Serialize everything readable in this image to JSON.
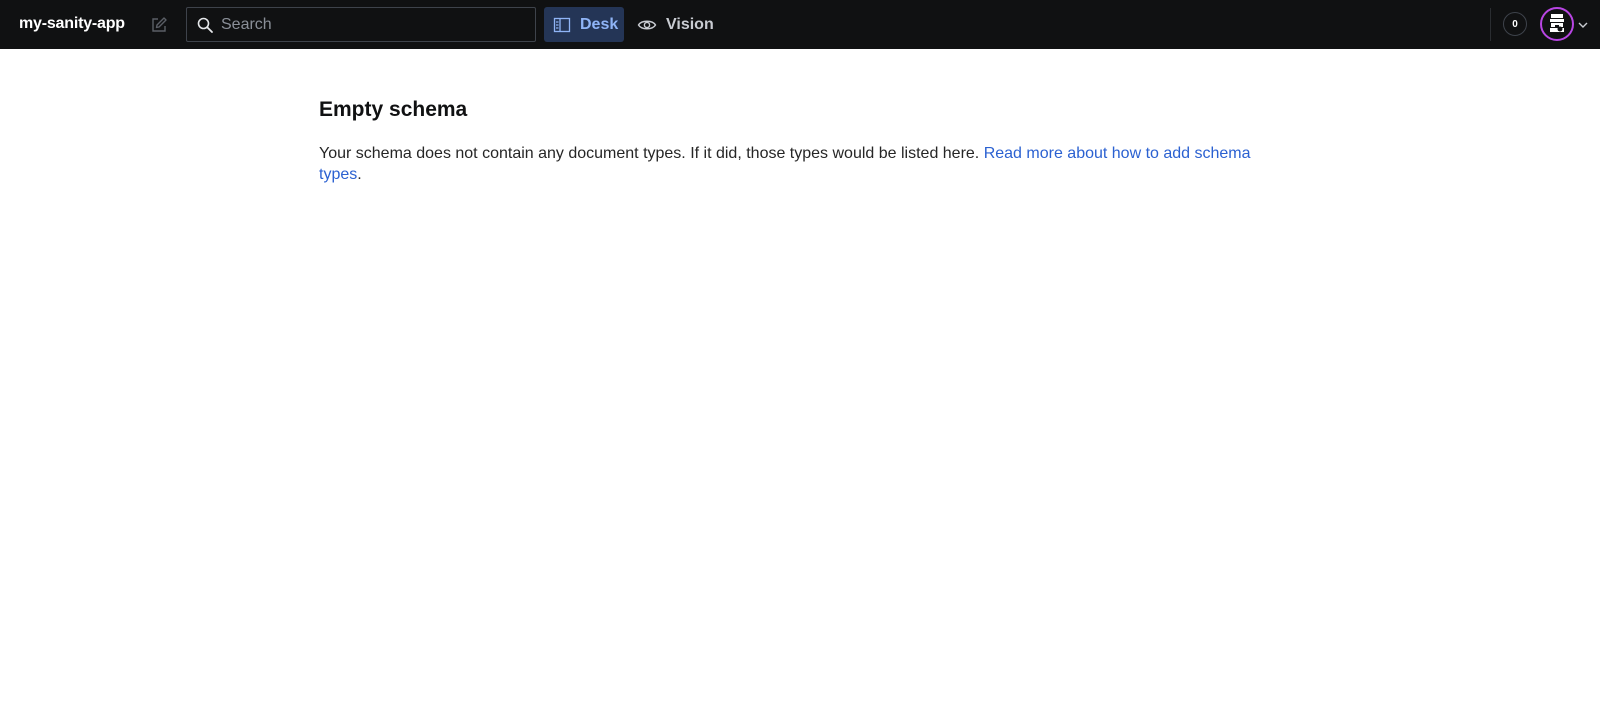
{
  "topbar": {
    "project_name": "my-sanity-app",
    "compose_icon": "compose-icon",
    "search": {
      "placeholder": "Search",
      "value": "",
      "icon": "search-icon"
    },
    "tools": [
      {
        "label": "Desk",
        "icon": "desk-icon",
        "active": true
      },
      {
        "label": "Vision",
        "icon": "eye-icon",
        "active": false
      }
    ],
    "notification_count": "0",
    "avatar_icon": "user-avatar",
    "menu_icon": "chevron-down-icon"
  },
  "colors": {
    "topbar_bg": "#101112",
    "active_tool_bg": "#243556",
    "active_tool_text": "#8fb4f6",
    "link": "#2b61d1",
    "avatar_ring": "#b845e3"
  },
  "main": {
    "title": "Empty schema",
    "description": "Your schema does not contain any document types. If it did, those types would be listed here.",
    "link_text": "Read more about how to add schema types",
    "trailing": "."
  }
}
